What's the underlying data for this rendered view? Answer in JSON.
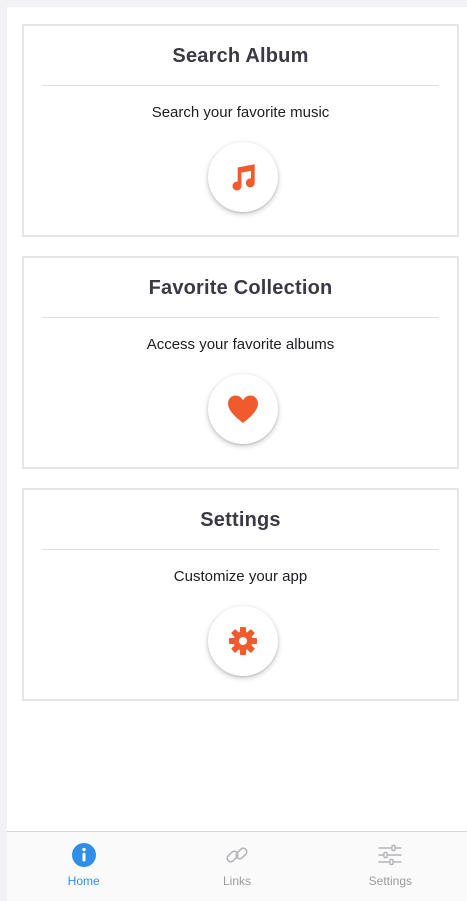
{
  "cards": [
    {
      "title": "Search Album",
      "subtitle": "Search your favorite music",
      "icon": "music-note-icon"
    },
    {
      "title": "Favorite Collection",
      "subtitle": "Access your favorite albums",
      "icon": "heart-icon"
    },
    {
      "title": "Settings",
      "subtitle": "Customize your app",
      "icon": "gear-icon"
    }
  ],
  "tabbar": {
    "tabs": [
      {
        "label": "Home",
        "icon": "info-icon",
        "active": true
      },
      {
        "label": "Links",
        "icon": "link-icon",
        "active": false
      },
      {
        "label": "Settings",
        "icon": "sliders-icon",
        "active": false
      }
    ]
  },
  "colors": {
    "accent": "#f05a2c",
    "active_tab": "#2f8ee6",
    "inactive_tab": "#9a9aa0"
  }
}
